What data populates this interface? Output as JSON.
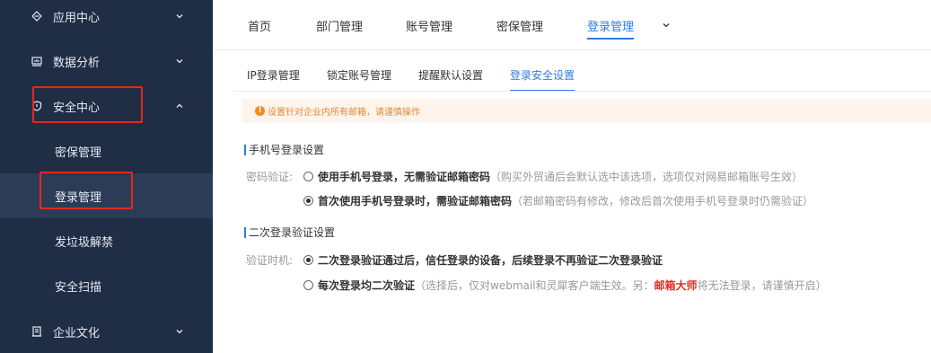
{
  "sidebar": {
    "items": [
      {
        "label": "应用中心",
        "icon": "app-center-icon"
      },
      {
        "label": "数据分析",
        "icon": "data-analysis-icon"
      },
      {
        "label": "安全中心",
        "icon": "shield-icon"
      },
      {
        "label": "企业文化",
        "icon": "culture-icon"
      }
    ],
    "security_children": [
      "密保管理",
      "登录管理",
      "发垃圾解禁",
      "安全扫描"
    ],
    "active_child": "登录管理"
  },
  "top_tabs": [
    "首页",
    "部门管理",
    "账号管理",
    "密保管理",
    "登录管理"
  ],
  "top_tabs_active": "登录管理",
  "sub_tabs": [
    "IP登录管理",
    "锁定账号管理",
    "提醒默认设置",
    "登录安全设置"
  ],
  "sub_tabs_active": "登录安全设置",
  "notice": {
    "icon": "!",
    "text": "设置针对企业内所有邮箱，请谨慎操作"
  },
  "phone_login": {
    "title": "手机号登录设置",
    "label": "密码验证:",
    "option1_bold": "使用手机号登录，无需验证邮箱密码",
    "option1_note": "（购买外贸通后会默认选中该选项，选项仅对网易邮箱账号生效）",
    "option2_bold": "首次使用手机号登录时，需验证邮箱密码",
    "option2_note": "（若邮箱密码有修改，修改后首次使用手机号登录时仍需验证）",
    "selected": 2
  },
  "second_verify": {
    "title": "二次登录验证设置",
    "label": "验证时机:",
    "option1_bold": "二次登录验证通过后，信任登录的设备，后续登录不再验证二次登录验证",
    "option2_bold": "每次登录均二次验证",
    "option2_note_a": "（选择后，仅对webmail和灵犀客户端生效。另：",
    "option2_red": "邮箱大师",
    "option2_note_b": "将无法登录，请谨慎开启）",
    "selected": 1
  },
  "colors": {
    "sidebar_bg": "#1f2d45",
    "accent": "#2f7be5",
    "highlight_box": "#e5281d",
    "notice_bg": "#fdf4ec",
    "notice_text": "#e48a3a"
  }
}
